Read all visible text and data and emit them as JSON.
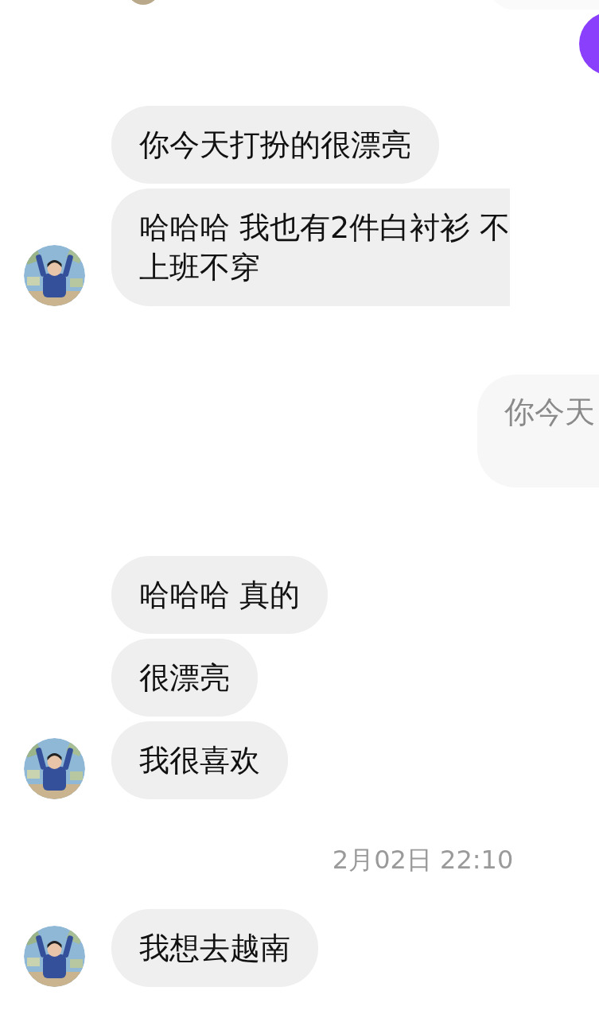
{
  "items": [
    {
      "kind": "incoming",
      "bubbles": [
        {
          "lines": [
            "你今天打扮的很漂亮"
          ],
          "cut": false
        },
        {
          "lines": [
            "哈哈哈 我也有2件白衬衫 不",
            "上班不穿"
          ],
          "cut": true
        }
      ]
    },
    {
      "kind": "outgoing",
      "bubbles": [
        {
          "lines": [
            "你今天"
          ],
          "cut": true
        }
      ]
    },
    {
      "kind": "incoming",
      "bubbles": [
        {
          "lines": [
            "哈哈哈 真的"
          ],
          "cut": false
        },
        {
          "lines": [
            "很漂亮"
          ],
          "cut": false
        },
        {
          "lines": [
            "我很喜欢"
          ],
          "cut": false
        }
      ]
    },
    {
      "kind": "timestamp",
      "text": "2月02日 22:10"
    },
    {
      "kind": "incoming",
      "bubbles": [
        {
          "lines": [
            "我想去越南"
          ],
          "cut": false
        }
      ]
    }
  ]
}
